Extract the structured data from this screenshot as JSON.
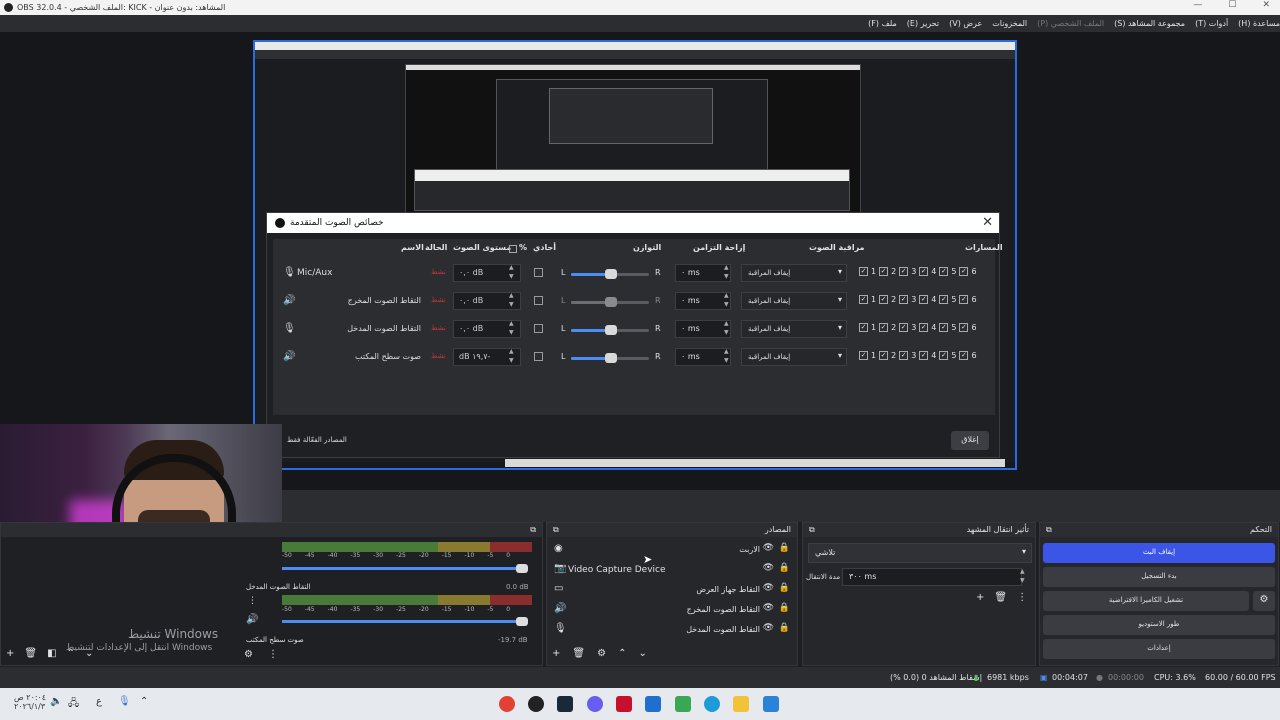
{
  "window": {
    "title": "OBS 32.0.4 - الملف الشخصي: KICK - المشاهد: بدون عنوان"
  },
  "menu": [
    "ملف (F)",
    "تحرير (E)",
    "عرض (V)",
    "المخزونات",
    "الملف الشخصي (P)",
    "مجموعة المشاهد (S)",
    "أدوات (T)",
    "مساعدة (H)"
  ],
  "dialog": {
    "title": "خصائص الصوت المتقدمة",
    "headers": {
      "name": "الاسم",
      "status": "الحالة",
      "volume": "مستوى الصوت",
      "percent": "%",
      "mono": "أحادي",
      "balance": "التوازن",
      "sync_offset": "إزاحة التزامن",
      "monitoring": "مراقبة الصوت",
      "tracks": "المسارات"
    },
    "rows": [
      {
        "name": "Mic/Aux",
        "status": "نشط",
        "volume": "٠,٠ dB",
        "offset": "٠ ms",
        "monitoring": "إيقاف المراقبة"
      },
      {
        "name": "التقاط الصوت المخرج",
        "status": "نشط",
        "volume": "٠,٠ dB",
        "offset": "٠ ms",
        "monitoring": "إيقاف المراقبة"
      },
      {
        "name": "التقاط الصوت المدخل",
        "status": "نشط",
        "volume": "٠,٠ dB",
        "offset": "٠ ms",
        "monitoring": "إيقاف المراقبة"
      },
      {
        "name": "صوت سطح المكتب",
        "status": "نشط",
        "volume": "dB ١٩,٧-",
        "offset": "٠ ms",
        "monitoring": "إيقاف المراقبة"
      }
    ],
    "balance_L": "L",
    "balance_R": "R",
    "track_numbers": [
      "1",
      "2",
      "3",
      "4",
      "5",
      "6"
    ],
    "active_only": "المصادر الفعّالة فقط",
    "close_label": "إغلاق"
  },
  "mixer": {
    "ticks": [
      "-60",
      "-55",
      "-50",
      "-45",
      "-40",
      "-35",
      "-30",
      "-25",
      "-20",
      "-15",
      "-10",
      "-5",
      "0"
    ],
    "channels": [
      {
        "name": "التقاط الصوت المدخل",
        "db": "0.0 dB"
      },
      {
        "name": "صوت سطح المكتب",
        "db": "-19.7 dB"
      }
    ]
  },
  "sources": {
    "title": "المصادر",
    "items": [
      {
        "label": "الاربت",
        "icon": "browser-icon"
      },
      {
        "label": "Video Capture Device",
        "icon": "camera-icon"
      },
      {
        "label": "التقاط جهاز العرض",
        "icon": "monitor-icon"
      },
      {
        "label": "التقاط الصوت المخرج",
        "icon": "speaker-icon"
      },
      {
        "label": "التقاط الصوت المدخل",
        "icon": "mic-icon"
      }
    ]
  },
  "transitions": {
    "title": "تأثير انتقال المشهد",
    "selected": "تلاشي",
    "duration_label": "مدة الانتقال",
    "duration": "٣٠٠ ms"
  },
  "controls": {
    "title": "التحكم",
    "buttons": [
      "إيقاف البث",
      "بدء التسجيل",
      "تشغيل الكاميرا الافتراضية",
      "طور الاستوديو",
      "إعدادات"
    ]
  },
  "status": {
    "dropped": "إسقاط المشاهد 0 (0.0 %)",
    "bitrate": "6981 kbps",
    "stream_time": "00:04:07",
    "rec_time": "00:00:00",
    "cpu": "CPU: 3.6%",
    "fps": "60.00 / 60.00 FPS"
  },
  "watermark": {
    "title": "تنشيط Windows",
    "sub": "انتقل إلى الإعدادات لتنشيط Windows"
  },
  "taskbar": {
    "time": "٢٠:٠٤ ص",
    "date": "٢٠٢٦/١/٣"
  }
}
